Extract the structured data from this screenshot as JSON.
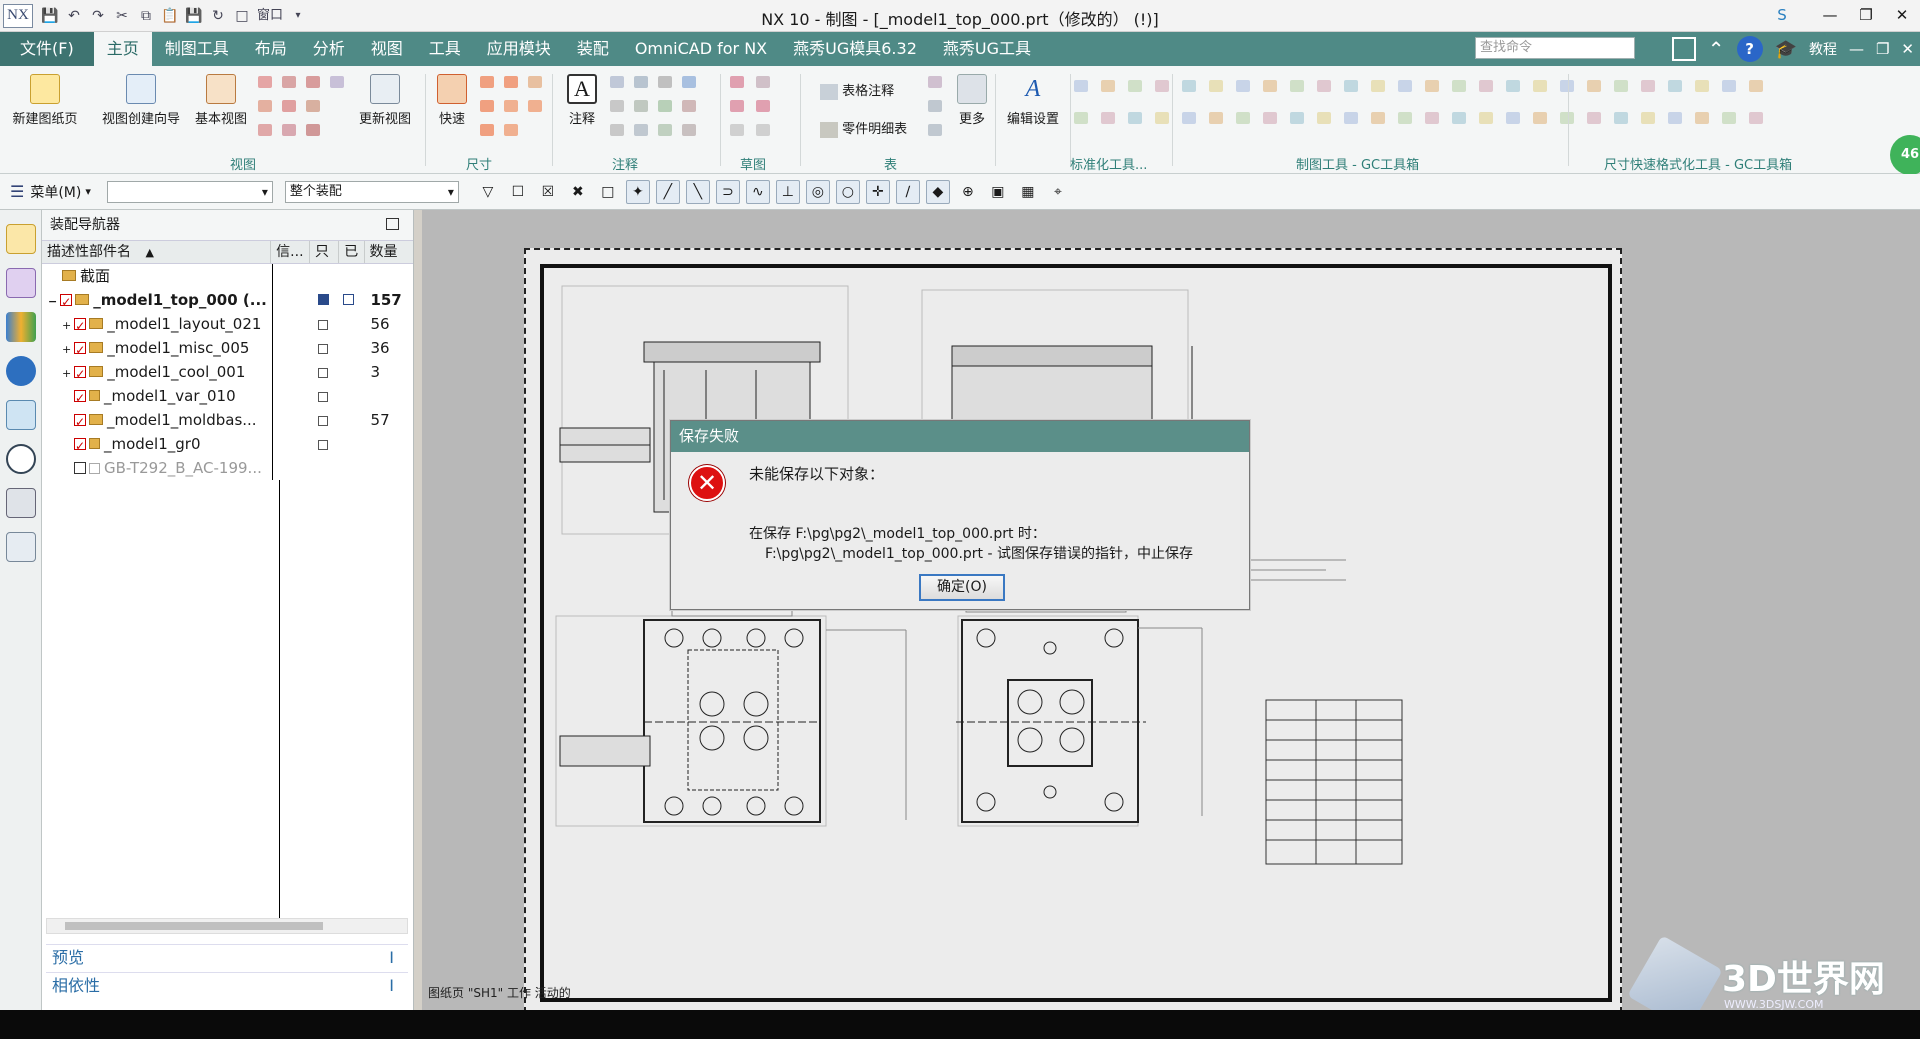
{
  "app": {
    "logo": "NX",
    "window_title": "NX 10 - 制图 - [_model1_top_000.prt（修改的） (!)]",
    "window_menu_label": "窗口",
    "user_initial": "S",
    "tutorial_label": "教程",
    "search_placeholder": "查找命令"
  },
  "menubar": {
    "file": "文件(F)",
    "tabs": [
      "主页",
      "制图工具",
      "布局",
      "分析",
      "视图",
      "工具",
      "应用模块",
      "装配",
      "OmniCAD for NX",
      "燕秀UG模具6.32",
      "燕秀UG工具"
    ]
  },
  "ribbon": {
    "buttons": {
      "new_sheet": "新建图纸页",
      "view_wizard": "视图创建向导",
      "base_view": "基本视图",
      "update_view": "更新视图",
      "rapid": "快速",
      "note": "注释",
      "table_note": "表格注释",
      "parts_list": "零件明细表",
      "more": "更多",
      "edit_settings": "编辑设置"
    },
    "groups": {
      "view": "视图",
      "dimension": "尺寸",
      "annotation": "注释",
      "sketch": "草图",
      "table": "表",
      "standardization": "标准化工具...",
      "drafting_gc": "制图工具 - GC工具箱",
      "dim_format_gc": "尺寸快速格式化工具 - GC工具箱"
    }
  },
  "cmdbar": {
    "menu_label": "菜单(M)",
    "filter_value": "",
    "scope_value": "整个装配"
  },
  "navigator": {
    "title": "装配导航器",
    "columns": [
      "描述性部件名",
      "信...",
      "只",
      "已",
      "数量"
    ],
    "rows": [
      {
        "name": "截面",
        "qty": ""
      },
      {
        "name": "_model1_top_000 (...",
        "qty": "157"
      },
      {
        "name": "_model1_layout_021",
        "qty": "56"
      },
      {
        "name": "_model1_misc_005",
        "qty": "36"
      },
      {
        "name": "_model1_cool_001",
        "qty": "3"
      },
      {
        "name": "_model1_var_010",
        "qty": ""
      },
      {
        "name": "_model1_moldbas...",
        "qty": "57"
      },
      {
        "name": "_model1_gr0",
        "qty": ""
      },
      {
        "name": "GB-T292_B_AC-199...",
        "qty": ""
      }
    ],
    "preview": "预览",
    "dependencies": "相依性"
  },
  "drawing": {
    "sheet_status": "图纸页 \"SH1\" 工作 活动的"
  },
  "dialog": {
    "title": "保存失败",
    "message": "未能保存以下对象：",
    "detail_line1": "在保存 F:\\pg\\pg2\\_model1_top_000.prt 时：",
    "detail_line2": "F:\\pg\\pg2\\_model1_top_000.prt - 试图保存错误的指针，中止保存",
    "ok": "确定(O)"
  },
  "watermark": {
    "text": "3D世界网",
    "url": "WWW.3DSJW.COM"
  },
  "badge": "46",
  "colors": {
    "menubar": "#4f8a86",
    "dialog_title": "#5b8f89",
    "accent_text": "#2f7f78"
  }
}
